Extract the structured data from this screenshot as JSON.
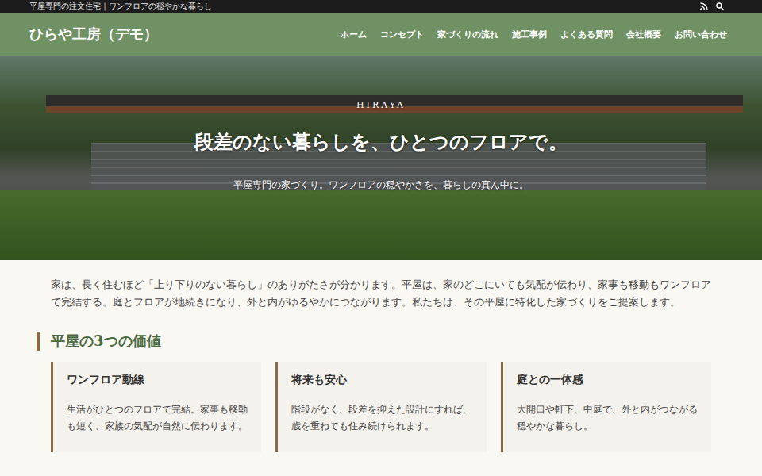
{
  "topbar": {
    "text": "平屋専門の注文住宅｜ワンフロアの穏やかな暮らし"
  },
  "header": {
    "logo": "ひらや工房（デモ）",
    "nav": [
      {
        "label": "ホーム",
        "selected": false
      },
      {
        "label": "コンセプト",
        "selected": false
      },
      {
        "label": "家づくりの流れ",
        "selected": false
      },
      {
        "label": "施工事例",
        "selected": false
      },
      {
        "label": "よくある質問",
        "selected": false
      },
      {
        "label": "会社概要",
        "selected": false
      },
      {
        "label": "お問い合わせ",
        "selected": false
      }
    ]
  },
  "hero": {
    "eyebrow": "HIRAYA",
    "title": "段差のない暮らしを、ひとつのフロアで。",
    "subtitle": "平屋専門の家づくり。ワンフロアの穏やかさを、暮らしの真ん中に。"
  },
  "intro": "家は、長く住むほど「上り下りのない暮らし」のありがたさが分かります。平屋は、家のどこにいても気配が伝わり、家事も移動もワンフロアで完結する。庭とフロアが地続きになり、外と内がゆるやかにつながります。私たちは、その平屋に特化した家づくりをご提案します。",
  "section": {
    "heading": "平屋の3つの価値",
    "cards": [
      {
        "title": "ワンフロア動線",
        "body": "生活がひとつのフロアで完結。家事も移動も短く、家族の気配が自然に伝わります。"
      },
      {
        "title": "将来も安心",
        "body": "階段がなく、段差を抑えた設計にすれば、歳を重ねても住み続けられます。"
      },
      {
        "title": "庭との一体感",
        "body": "大開口や軒下、中庭で、外と内がつながる穏やかな暮らし。"
      }
    ]
  }
}
